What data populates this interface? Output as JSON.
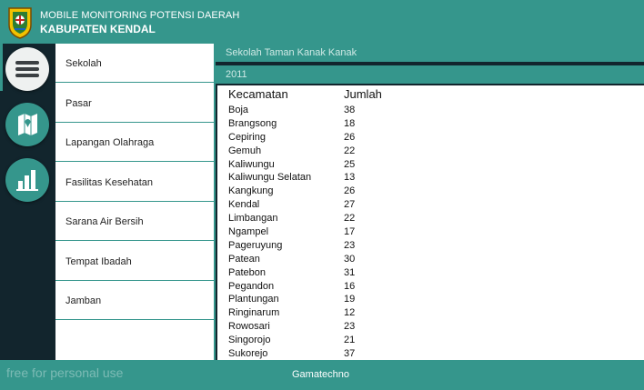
{
  "header": {
    "subtitle": "MOBILE MONITORING POTENSI DAERAH",
    "title": "KABUPATEN KENDAL",
    "bg_color": "#35968c"
  },
  "rail": {
    "menu_icon": "hamburger-menu-icon",
    "map_icon": "map-icon",
    "chart_icon": "bar-chart-icon"
  },
  "nav": {
    "items": [
      {
        "label": "Sekolah"
      },
      {
        "label": "Pasar"
      },
      {
        "label": "Lapangan Olahraga"
      },
      {
        "label": "Fasilitas Kesehatan"
      },
      {
        "label": "Sarana Air Bersih"
      },
      {
        "label": "Tempat Ibadah"
      },
      {
        "label": "Jamban"
      }
    ]
  },
  "content": {
    "category": "Sekolah Taman Kanak Kanak",
    "year": "2011",
    "col_kecamatan": "Kecamatan",
    "col_jumlah": "Jumlah",
    "rows": [
      {
        "kecamatan": "Boja",
        "jumlah": "38"
      },
      {
        "kecamatan": "Brangsong",
        "jumlah": "18"
      },
      {
        "kecamatan": "Cepiring",
        "jumlah": "26"
      },
      {
        "kecamatan": "Gemuh",
        "jumlah": "22"
      },
      {
        "kecamatan": "Kaliwungu",
        "jumlah": "25"
      },
      {
        "kecamatan": "Kaliwungu Selatan",
        "jumlah": "13"
      },
      {
        "kecamatan": "Kangkung",
        "jumlah": "26"
      },
      {
        "kecamatan": "Kendal",
        "jumlah": "27"
      },
      {
        "kecamatan": "Limbangan",
        "jumlah": "22"
      },
      {
        "kecamatan": "Ngampel",
        "jumlah": "17"
      },
      {
        "kecamatan": "Pageruyung",
        "jumlah": "23"
      },
      {
        "kecamatan": "Patean",
        "jumlah": "30"
      },
      {
        "kecamatan": "Patebon",
        "jumlah": "31"
      },
      {
        "kecamatan": "Pegandon",
        "jumlah": "16"
      },
      {
        "kecamatan": "Plantungan",
        "jumlah": "19"
      },
      {
        "kecamatan": "Ringinarum",
        "jumlah": "12"
      },
      {
        "kecamatan": "Rowosari",
        "jumlah": "23"
      },
      {
        "kecamatan": "Singorojo",
        "jumlah": "21"
      },
      {
        "kecamatan": "Sukorejo",
        "jumlah": "37"
      }
    ]
  },
  "footer": {
    "watermark": "free for personal use",
    "brand": "Gamatechno"
  }
}
